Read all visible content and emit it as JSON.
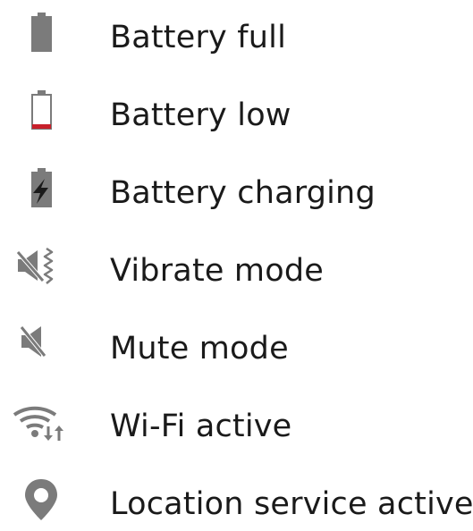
{
  "colors": {
    "icon_gray": "#7b7b7b",
    "low_battery_red": "#c8202b",
    "text": "#1a1a1a"
  },
  "items": [
    {
      "icon": "battery-full-icon",
      "label": "Battery full"
    },
    {
      "icon": "battery-low-icon",
      "label": "Battery low"
    },
    {
      "icon": "battery-charging-icon",
      "label": "Battery charging"
    },
    {
      "icon": "vibrate-mode-icon",
      "label": "Vibrate mode"
    },
    {
      "icon": "mute-mode-icon",
      "label": "Mute mode"
    },
    {
      "icon": "wifi-active-icon",
      "label": "Wi-Fi active"
    },
    {
      "icon": "location-service-icon",
      "label": "Location service active"
    }
  ]
}
